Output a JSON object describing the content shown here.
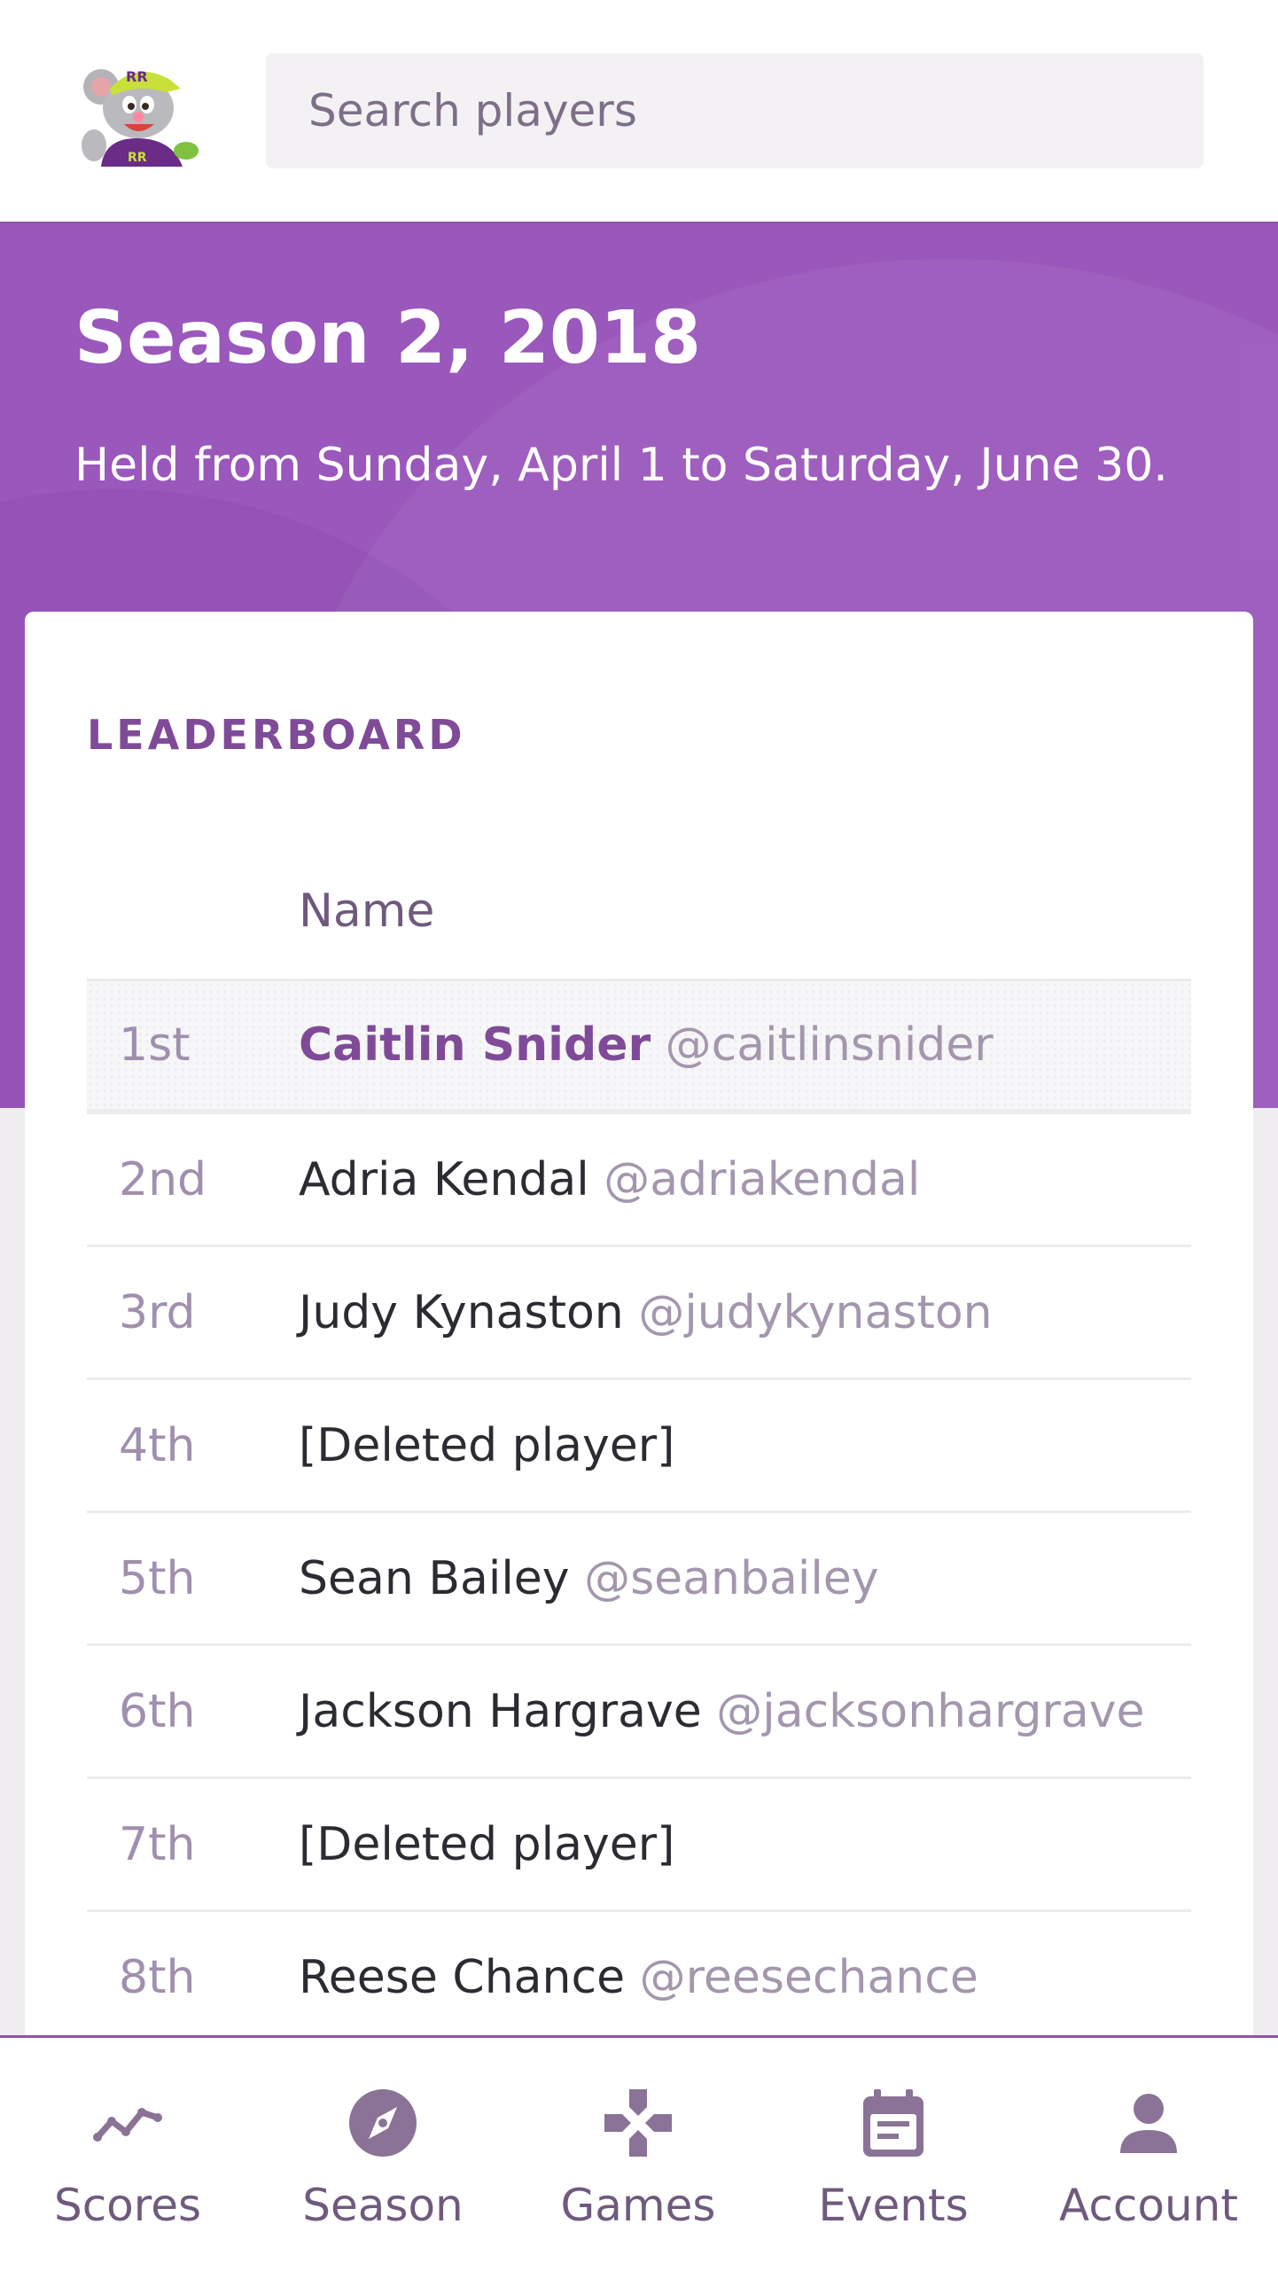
{
  "search": {
    "placeholder": "Search players"
  },
  "season": {
    "title": "Season 2, 2018",
    "subtitle": "Held from Sunday, April 1 to Saturday, June 30."
  },
  "leaderboard": {
    "heading": "LEADERBOARD",
    "column_name": "Name",
    "rows": [
      {
        "rank": "1st",
        "name": "Caitlin Snider",
        "handle": "@caitlinsnider"
      },
      {
        "rank": "2nd",
        "name": "Adria Kendal",
        "handle": "@adriakendal"
      },
      {
        "rank": "3rd",
        "name": "Judy Kynaston",
        "handle": "@judykynaston"
      },
      {
        "rank": "4th",
        "name": "[Deleted player]",
        "handle": ""
      },
      {
        "rank": "5th",
        "name": "Sean Bailey",
        "handle": "@seanbailey"
      },
      {
        "rank": "6th",
        "name": "Jackson Hargrave",
        "handle": "@jacksonhargrave"
      },
      {
        "rank": "7th",
        "name": "[Deleted player]",
        "handle": ""
      },
      {
        "rank": "8th",
        "name": "Reese Chance",
        "handle": "@reesechance"
      }
    ]
  },
  "nav": {
    "items": [
      {
        "label": "Scores",
        "icon": "trend-line-icon"
      },
      {
        "label": "Season",
        "icon": "compass-icon"
      },
      {
        "label": "Games",
        "icon": "gamepad-icon"
      },
      {
        "label": "Events",
        "icon": "calendar-icon"
      },
      {
        "label": "Account",
        "icon": "person-icon"
      }
    ]
  },
  "colors": {
    "brand": "#9a57bc",
    "accent_text": "#7f4b98",
    "icon": "#8a7396"
  }
}
